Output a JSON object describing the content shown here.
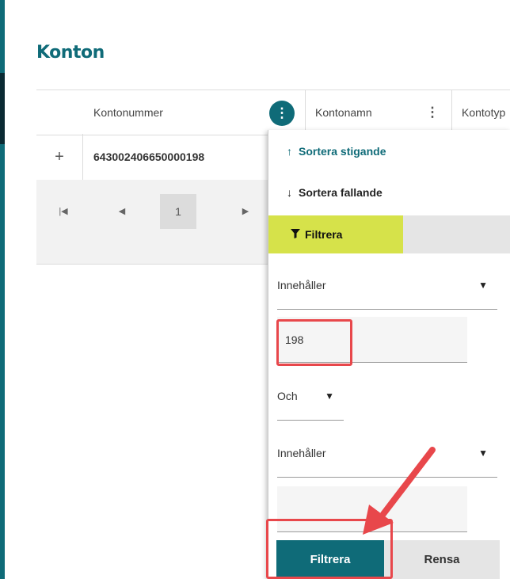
{
  "page": {
    "title": "Konton"
  },
  "grid": {
    "columns": [
      {
        "label": "Kontonummer"
      },
      {
        "label": "Kontonamn"
      },
      {
        "label": "Kontotyp"
      }
    ],
    "rows": [
      {
        "account_number": "643002406650000198"
      }
    ],
    "pager": {
      "current_page": "1"
    }
  },
  "column_menu": {
    "sort_ascending": "Sortera stigande",
    "sort_descending": "Sortera fallande",
    "filter_tab": "Filtrera",
    "filter": {
      "operator1": "Innehåller",
      "value1": "198",
      "logic": "Och",
      "operator2": "Innehåller",
      "value2": "",
      "apply_label": "Filtrera",
      "clear_label": "Rensa"
    }
  },
  "colors": {
    "accent": "#0f6b78",
    "filter_tab": "#d6e24a",
    "highlight": "#e8474b"
  },
  "icons": {
    "sort_asc": "arrow-up-icon",
    "sort_desc": "arrow-down-icon",
    "filter": "funnel-icon",
    "column_menu": "kebab-icon",
    "expand": "plus-icon",
    "pager_first": "skip-first-icon",
    "pager_prev": "prev-icon",
    "pager_next": "next-icon"
  }
}
